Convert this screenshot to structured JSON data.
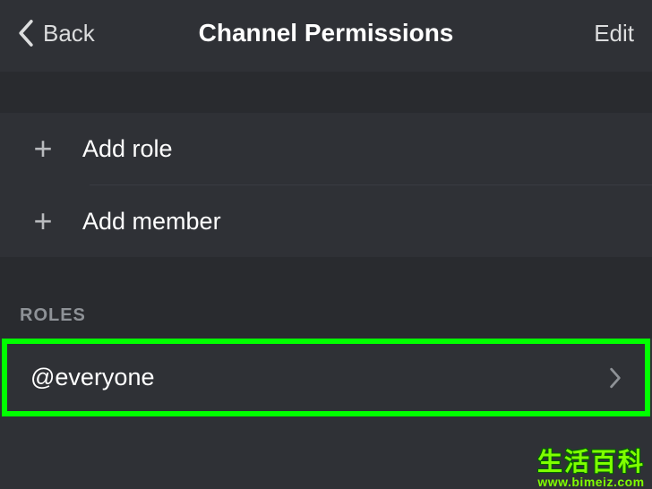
{
  "header": {
    "back_label": "Back",
    "title": "Channel Permissions",
    "edit_label": "Edit"
  },
  "actions": {
    "add_role_label": "Add role",
    "add_member_label": "Add member"
  },
  "section": {
    "roles_header": "ROLES"
  },
  "roles": [
    {
      "name": "@everyone"
    }
  ],
  "watermark": {
    "cn": "生活百科",
    "url": "www.bimeiz.com"
  },
  "highlight_color": "#00ff00"
}
